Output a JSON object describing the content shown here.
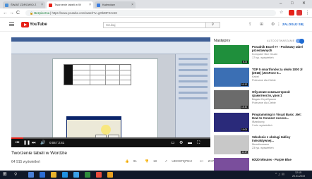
{
  "browser": {
    "tabs": [
      {
        "label": "ŚWIAT ZDROWIO Z",
        "active": false
      },
      {
        "label": "Tworzenie tabeli w W",
        "active": true
      },
      {
        "label": "Kalendarz",
        "active": false
      }
    ],
    "address": {
      "secure_label": "Bezpieczna",
      "url": "https://www.youtube.com/watch?v=gObDtFKm1M"
    },
    "nav": {
      "back": "←",
      "forward": "→",
      "reload": "C",
      "home": "⌂"
    }
  },
  "youtube": {
    "logo_text": "YouTube",
    "search_placeholder": "Szukaj",
    "signin_label": "ZALOGUJ SIĘ"
  },
  "player": {
    "progress": 0.06,
    "time": "0:04 / 2:41"
  },
  "video": {
    "title": "Tworzenie tabeli w Wordzie",
    "views": "64 915 wyświetleń",
    "likes": "91",
    "dislikes": "18",
    "share_label": "UDOSTĘPNIJ",
    "save_label": "ZAPISZ"
  },
  "sidebar": {
    "next_label": "Następny",
    "autoplay_label": "AUTOODTWARZANIE",
    "items": [
      {
        "title": "Poradnik Excel #7 - Podstawy tabel przestawnych",
        "channel": "Komputer Bez Gruzin",
        "meta": "17 tys. wyświetleń",
        "duration": "8:23",
        "color": "#1f8f3c"
      },
      {
        "title": "TOP 5 smartfonów za około 1000 zł (2018) | ZenFone 5...",
        "channel": "Kabel",
        "meta": "Polecane dla Ciebie",
        "duration": "10:12",
        "color": "#3b6fb4"
      },
      {
        "title": "Обучение компьютерной грамотности, урок 1",
        "channel": "Вадим Серебряков",
        "meta": "Polecane dla Ciebie",
        "duration": "15:40",
        "color": "#6b6b6b"
      },
      {
        "title": "Programming in Visual Basic .Net: How to Connect Access...",
        "channel": "iBasskung",
        "meta": "3 mln wyświetleń",
        "duration": "19:05",
        "color": "#2a2a7a"
      },
      {
        "title": "Szkolenie z obsługi tablicy interaktywnej...",
        "channel": "Mezalinowane",
        "meta": "23 tys. wyświetleń",
        "duration": "11:47",
        "color": "#c8c8c8"
      },
      {
        "title": "60/20 Minutes - Purple Blue",
        "channel": "",
        "meta": "",
        "duration": "",
        "color": "#7a4e9c"
      }
    ]
  },
  "taskbar": {
    "time": "12:15",
    "date": "20.01.2019"
  }
}
